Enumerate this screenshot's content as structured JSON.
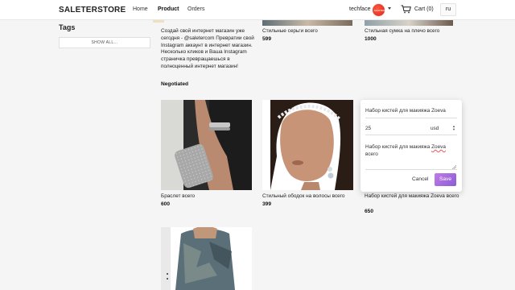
{
  "nav": {
    "brand": "SALETERSTORE",
    "links": [
      "Home",
      "Product",
      "Orders"
    ],
    "active": "Product",
    "user": "techface",
    "avatar_text": "SALETER",
    "cart_label": "Cart (0)",
    "lang": "ru"
  },
  "sidebar": {
    "title": "Tags",
    "show_all": "SHOW ALL..."
  },
  "products": [
    {
      "title": "Создай свой интернет магазин уже сегодня - @saletercom Превратии свой Instagram аккаунт в интернет магазин. Несколько кликов и Ваша Instagram страничка превращаешься в полноценный интернет магазин!",
      "price": "Negotiated"
    },
    {
      "title": "Стильные серьги всего",
      "price": "599"
    },
    {
      "title": "Стильная сумка на плечо всего",
      "price": "1000"
    },
    {
      "title": "Браслет всего",
      "price": "600"
    },
    {
      "title": "Стильный ободок на волосы всего",
      "price": "399"
    },
    {
      "title": "Набор кистей для макияжа Zoeva всего",
      "price": "650"
    }
  ],
  "popup": {
    "title": "Набор кистей для макияжа Zoeva",
    "price_value": "25",
    "currency": "usd",
    "description_start": "Набор кистей для макияжа",
    "description_word": "Zoeva",
    "description_end": "всего",
    "cancel": "Cancel",
    "save": "Save"
  },
  "colors": {
    "save_gradient_start": "#c17be5",
    "save_gradient_end": "#8a5cd6",
    "avatar": "#e0301e"
  }
}
